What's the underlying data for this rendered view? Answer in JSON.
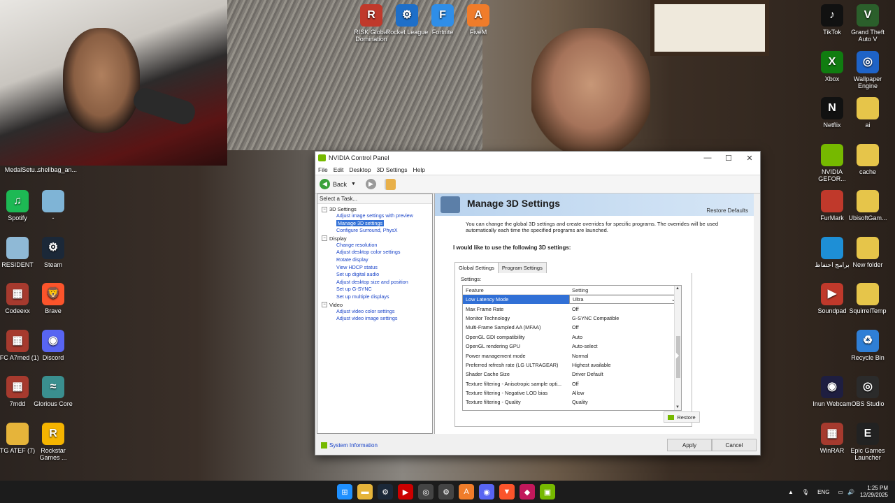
{
  "desktop": {
    "left_icons": [
      {
        "label": "MedalSetu...",
        "color": "#c1392b",
        "glyph": ""
      },
      {
        "label": "shellbag_an...",
        "color": "#555",
        "glyph": ""
      },
      {
        "label": "Spotify",
        "color": "#1db954",
        "glyph": "♫"
      },
      {
        "label": "-",
        "color": "#7fb4d6",
        "glyph": ""
      },
      {
        "label": "RESIDENT",
        "color": "#8fb9d6",
        "glyph": ""
      },
      {
        "label": "Steam",
        "color": "#1b2838",
        "glyph": "⚙"
      },
      {
        "label": "Codeexx",
        "color": "#a63a2e",
        "glyph": "▦"
      },
      {
        "label": "Brave",
        "color": "#fb542b",
        "glyph": "🦁"
      },
      {
        "label": "FFC A7med (1)",
        "color": "#a63a2e",
        "glyph": "▦"
      },
      {
        "label": "Discord",
        "color": "#5865f2",
        "glyph": "◉"
      },
      {
        "label": "7mdd",
        "color": "#a63a2e",
        "glyph": "▦"
      },
      {
        "label": "Glorious Core",
        "color": "#3a8f8f",
        "glyph": "≈"
      },
      {
        "label": "TG ATEF (7)",
        "color": "#e6b43a",
        "glyph": ""
      },
      {
        "label": "Rockstar Games ...",
        "color": "#f5b400",
        "glyph": "R"
      }
    ],
    "top_icons": [
      {
        "label": "RISK Global Domination",
        "color": "#c0392b",
        "glyph": "R"
      },
      {
        "label": "Rocket League",
        "color": "#1e6fc9",
        "glyph": "⚙"
      },
      {
        "label": "Fortnite",
        "color": "#2f8ee8",
        "glyph": "F"
      },
      {
        "label": "FiveM",
        "color": "#f07c2a",
        "glyph": "A"
      }
    ],
    "right_icons": [
      {
        "label": "TikTok",
        "color": "#111",
        "glyph": "♪"
      },
      {
        "label": "Grand Theft Auto V",
        "color": "#2b5f2b",
        "glyph": "V"
      },
      {
        "label": "Xbox",
        "color": "#107c10",
        "glyph": "X"
      },
      {
        "label": "Wallpaper Engine",
        "color": "#1e63c7",
        "glyph": "◎"
      },
      {
        "label": "Netflix",
        "color": "#111",
        "glyph": "N"
      },
      {
        "label": "ai",
        "color": "#e6c54a",
        "glyph": ""
      },
      {
        "label": "NVIDIA GEFOR...",
        "color": "#76b900",
        "glyph": ""
      },
      {
        "label": "cache",
        "color": "#e6c54a",
        "glyph": ""
      },
      {
        "label": "FurMark",
        "color": "#c0392b",
        "glyph": ""
      },
      {
        "label": "UbisoftGam...",
        "color": "#e6c54a",
        "glyph": ""
      },
      {
        "label": "برامج احتفاظ",
        "color": "#1e8fd6",
        "glyph": ""
      },
      {
        "label": "New folder",
        "color": "#e6c54a",
        "glyph": ""
      },
      {
        "label": "Soundpad",
        "color": "#c0392b",
        "glyph": "▶"
      },
      {
        "label": "SquirrelTemp",
        "color": "#e6c54a",
        "glyph": ""
      },
      {
        "label": "",
        "color": "transparent",
        "glyph": ""
      },
      {
        "label": "Recycle Bin",
        "color": "#2f7fd6",
        "glyph": "♻"
      },
      {
        "label": "Inun Webcam",
        "color": "#1e1e40",
        "glyph": "◉"
      },
      {
        "label": "OBS Studio",
        "color": "#2b2b2b",
        "glyph": "◎"
      },
      {
        "label": "WinRAR",
        "color": "#a63a2e",
        "glyph": "▦"
      },
      {
        "label": "Epic Games Launcher",
        "color": "#222",
        "glyph": "E"
      }
    ]
  },
  "window": {
    "title": "NVIDIA Control Panel",
    "controls": {
      "minimize": "—",
      "maximize": "☐",
      "close": "✕"
    },
    "menu": [
      "File",
      "Edit",
      "Desktop",
      "3D Settings",
      "Help"
    ],
    "toolbar": {
      "back_label": "Back"
    },
    "task_header": "Select a Task...",
    "tree": [
      {
        "category": "3D Settings",
        "tasks": [
          {
            "label": "Adjust image settings with preview",
            "selected": false
          },
          {
            "label": "Manage 3D settings",
            "selected": true
          },
          {
            "label": "Configure Surround, PhysX",
            "selected": false
          }
        ]
      },
      {
        "category": "Display",
        "tasks": [
          {
            "label": "Change resolution",
            "selected": false
          },
          {
            "label": "Adjust desktop color settings",
            "selected": false
          },
          {
            "label": "Rotate display",
            "selected": false
          },
          {
            "label": "View HDCP status",
            "selected": false
          },
          {
            "label": "Set up digital audio",
            "selected": false
          },
          {
            "label": "Adjust desktop size and position",
            "selected": false
          },
          {
            "label": "Set up G-SYNC",
            "selected": false
          },
          {
            "label": "Set up multiple displays",
            "selected": false
          }
        ]
      },
      {
        "category": "Video",
        "tasks": [
          {
            "label": "Adjust video color settings",
            "selected": false
          },
          {
            "label": "Adjust video image settings",
            "selected": false
          }
        ]
      }
    ],
    "system_information": "System Information",
    "page_title": "Manage 3D Settings",
    "restore_defaults": "Restore Defaults",
    "description": "You can change the global 3D settings and create overrides for specific programs. The overrides will be used automatically each time the specified programs are launched.",
    "prompt": "I would like to use the following 3D settings:",
    "tabs": [
      {
        "label": "Global Settings",
        "active": true
      },
      {
        "label": "Program Settings",
        "active": false
      }
    ],
    "settings_label": "Settings:",
    "columns": {
      "feature": "Feature",
      "setting": "Setting"
    },
    "rows": [
      {
        "feature": "Low Latency Mode",
        "setting": "Ultra",
        "selected": true
      },
      {
        "feature": "Max Frame Rate",
        "setting": "Off"
      },
      {
        "feature": "Monitor Technology",
        "setting": "G-SYNC Compatible"
      },
      {
        "feature": "Multi-Frame Sampled AA (MFAA)",
        "setting": "Off"
      },
      {
        "feature": "OpenGL GDI compatibility",
        "setting": "Auto"
      },
      {
        "feature": "OpenGL rendering GPU",
        "setting": "Auto-select"
      },
      {
        "feature": "Power management mode",
        "setting": "Normal"
      },
      {
        "feature": "Preferred refresh rate (LG ULTRAGEAR)",
        "setting": "Highest available"
      },
      {
        "feature": "Shader Cache Size",
        "setting": "Driver Default"
      },
      {
        "feature": "Texture filtering - Anisotropic sample opti...",
        "setting": "Off"
      },
      {
        "feature": "Texture filtering - Negative LOD bias",
        "setting": "Allow"
      },
      {
        "feature": "Texture filtering - Quality",
        "setting": "Quality"
      }
    ],
    "restore_button": "Restore",
    "apply_button": "Apply",
    "cancel_button": "Cancel"
  },
  "taskbar": {
    "apps": [
      {
        "name": "start-button",
        "color": "#1e90ff",
        "glyph": "⊞"
      },
      {
        "name": "file-explorer",
        "color": "#e6b43a",
        "glyph": "▬"
      },
      {
        "name": "steam",
        "color": "#1b2838",
        "glyph": "⚙"
      },
      {
        "name": "youtube",
        "color": "#c00",
        "glyph": "▶"
      },
      {
        "name": "app-circle",
        "color": "#444",
        "glyph": "◎"
      },
      {
        "name": "settings",
        "color": "#444",
        "glyph": "⚙"
      },
      {
        "name": "fivem",
        "color": "#f07c2a",
        "glyph": "A"
      },
      {
        "name": "discord",
        "color": "#5865f2",
        "glyph": "◉"
      },
      {
        "name": "brave",
        "color": "#fb542b",
        "glyph": "▼"
      },
      {
        "name": "app-pink",
        "color": "#c2185b",
        "glyph": "◆"
      },
      {
        "name": "nvidia",
        "color": "#76b900",
        "glyph": "▣"
      }
    ],
    "language": "ENG",
    "time": "1:25 PM",
    "date": "12/29/2025"
  }
}
